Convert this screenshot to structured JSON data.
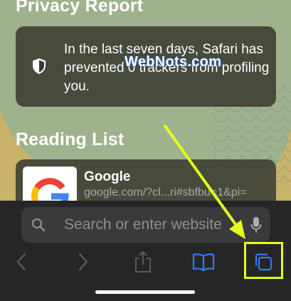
{
  "privacy": {
    "title": "Privacy Report",
    "message": "In the last seven days, Safari has prevented 0 trackers from profiling you."
  },
  "reading_list": {
    "title": "Reading List",
    "item": {
      "title": "Google",
      "url": "google.com/?cl...ri#sbfbu=1&pi="
    }
  },
  "watermark": "WebNots.com",
  "search": {
    "placeholder": "Search or enter website"
  },
  "toolbar": {
    "icons": [
      "back-icon",
      "forward-icon",
      "share-icon",
      "bookmarks-icon",
      "tabs-icon"
    ]
  },
  "colors": {
    "accent": "#3478f6",
    "highlight": "#e6ff1a",
    "card": "#3a3c30"
  }
}
